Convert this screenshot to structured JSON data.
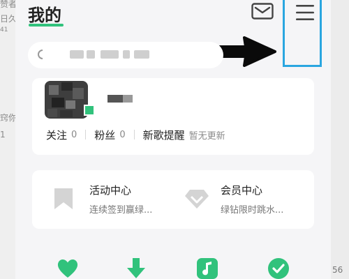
{
  "background": {
    "left_fragments": [
      "赞者",
      "日久",
      "41",
      "窍你",
      "1"
    ],
    "right_fragment": "56"
  },
  "header": {
    "title": "我的"
  },
  "colors": {
    "accent": "#31c27c",
    "highlight": "#2aa6e0"
  },
  "icons": {
    "mail": "mail-icon",
    "menu": "hamburger-menu-icon",
    "arrow": "arrow-right-icon",
    "search": "search-icon"
  },
  "profile": {
    "stats": [
      {
        "label": "关注",
        "value": "0"
      },
      {
        "label": "粉丝",
        "value": "0"
      }
    ],
    "new_song_alert": {
      "label": "新歌提醒",
      "status": "暂无更新"
    }
  },
  "features": [
    {
      "title": "活动中心",
      "subtitle": "连续签到赢绿...",
      "icon": "bookmark-icon"
    },
    {
      "title": "会员中心",
      "subtitle": "绿钻限时跳水...",
      "icon": "diamond-icon"
    }
  ],
  "shortcuts": [
    "heart-icon",
    "download-icon",
    "music-note-icon",
    "check-circle-icon"
  ]
}
